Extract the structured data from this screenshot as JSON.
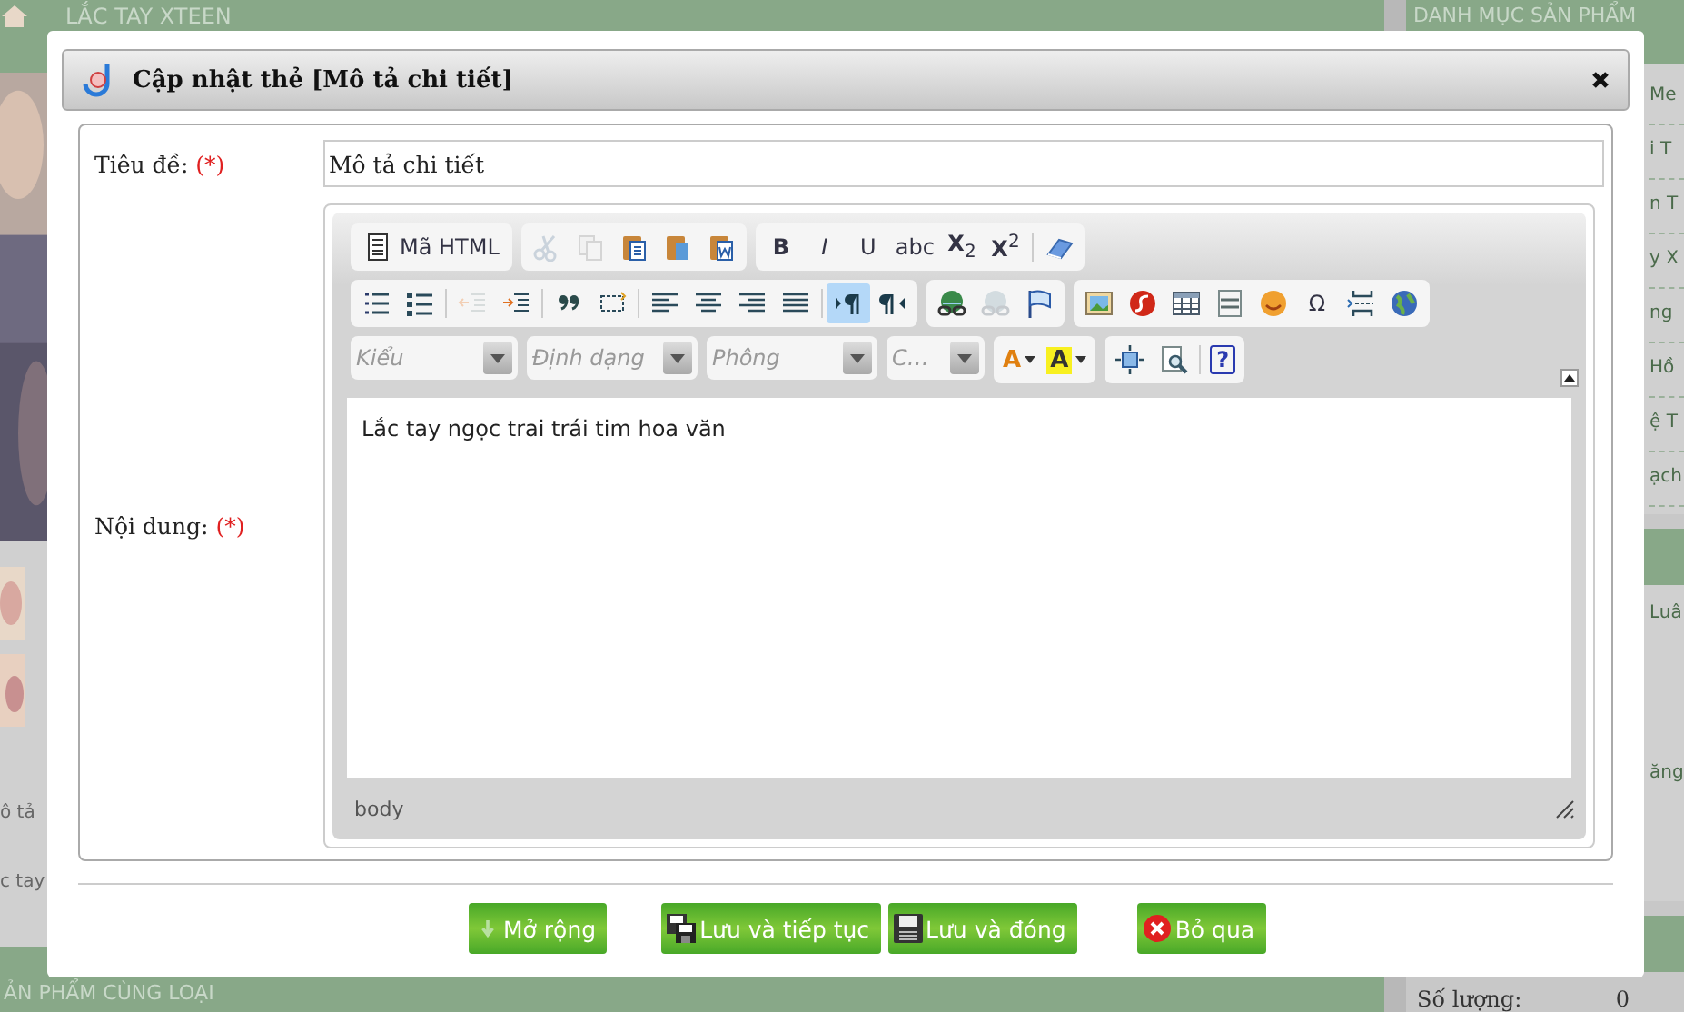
{
  "page": {
    "header": "LẮC TAY XTEEN",
    "footer_heading": "ẢN PHẨM CÙNG LOẠI",
    "left_texts": [
      "ô tả",
      "c tay"
    ],
    "sidebar": {
      "title": "DANH MỤC SẢN PHẨM",
      "items": [
        "Me",
        "i T",
        "n T",
        "y X",
        "ng",
        "Hồ",
        "ệ T",
        "ạch"
      ],
      "texts": [
        "Luâ",
        "ăng"
      ],
      "quantity_label": "Số lượng:",
      "quantity": "0"
    }
  },
  "dialog": {
    "title": "Cập nhật thẻ [Mô tả chi tiết]",
    "fields": [
      {
        "label": "Tiêu đề:",
        "required": "(*)",
        "value": "Mô tả chi tiết"
      },
      {
        "label": "Nội dung:",
        "required": "(*)"
      }
    ],
    "editor": {
      "toolbar": [
        [
          [
            {
              "kind": "source",
              "label": "Mã HTML",
              "selected": false,
              "disabled": false
            }
          ],
          [
            {
              "kind": "icon",
              "selected": false,
              "disabled": true
            },
            {
              "kind": "icon",
              "selected": false,
              "disabled": true
            },
            {
              "kind": "icon",
              "selected": false,
              "disabled": false
            },
            {
              "kind": "icon",
              "selected": false,
              "disabled": false
            },
            {
              "kind": "icon",
              "selected": false,
              "disabled": false
            }
          ],
          [
            {
              "kind": "label",
              "label": "**B**",
              "selected": false,
              "disabled": false
            },
            {
              "kind": "label",
              "label": "*I*",
              "selected": false,
              "disabled": false
            },
            {
              "kind": "label",
              "label": "U",
              "selected": false,
              "disabled": false
            },
            {
              "kind": "label",
              "label": "abc",
              "selected": false,
              "disabled": false
            },
            {
              "kind": "label",
              "label": "**X**$_{2}$",
              "selected": false,
              "disabled": false
            },
            {
              "kind": "label",
              "label": "**X**$^{2}$",
              "selected": false,
              "disabled": false
            },
            {
              "kind": "separator"
            },
            {
              "kind": "icon",
              "selected": false,
              "disabled": false
            }
          ]
        ],
        [
          [
            {
              "kind": "icon",
              "selected": false,
              "disabled": false
            },
            {
              "kind": "icon",
              "selected": false,
              "disabled": false
            },
            {
              "kind": "separator"
            },
            {
              "kind": "icon",
              "selected": false,
              "disabled": true
            },
            {
              "kind": "icon",
              "selected": false,
              "disabled": false
            },
            {
              "kind": "separator"
            },
            {
              "kind": "icon",
              "selected": false,
              "disabled": false
            },
            {
              "kind": "icon",
              "selected": false,
              "disabled": false
            },
            {
              "kind": "separator"
            },
            {
              "kind": "icon",
              "selected": false,
              "disabled": false
            },
            {
              "kind": "icon",
              "selected": false,
              "disabled": false
            },
            {
              "kind": "icon",
              "selected": false,
              "disabled": false
            },
            {
              "kind": "icon",
              "selected": false,
              "disabled": false
            },
            {
              "kind": "separator"
            },
            {
              "kind": "icon",
              "selected": true,
              "disabled": false
            },
            {
              "kind": "icon",
              "selected": false,
              "disabled": false
            }
          ],
          [
            {
              "kind": "icon",
              "selected": false,
              "disabled": false
            },
            {
              "kind": "icon",
              "selected": false,
              "disabled": true
            },
            {
              "kind": "icon",
              "selected": false,
              "disabled": false
            }
          ],
          [
            {
              "kind": "icon",
              "selected": false,
              "disabled": false
            },
            {
              "kind": "icon",
              "selected": false,
              "disabled": false
            },
            {
              "kind": "icon",
              "selected": false,
              "disabled": false
            },
            {
              "kind": "icon",
              "selected": false,
              "disabled": false
            },
            {
              "kind": "icon",
              "selected": false,
              "disabled": false
            },
            {
              "kind": "label",
              "label": "Ω",
              "selected": false,
              "disabled": false
            },
            {
              "kind": "icon",
              "selected": false,
              "disabled": false
            },
            {
              "kind": "icon",
              "selected": false,
              "disabled": false
            }
          ]
        ],
        [
          [
            {
              "kind": "dropdown",
              "placeholder": "Kiểu"
            }
          ],
          [
            {
              "kind": "dropdown",
              "placeholder": "Định dạng"
            }
          ],
          [
            {
              "kind": "dropdown",
              "placeholder": "Phông"
            }
          ],
          [
            {
              "kind": "dropdown",
              "placeholder": "C…"
            }
          ],
          [
            {
              "kind": "color",
              "label": "A",
              "selected": false,
              "disabled": false
            },
            {
              "kind": "color",
              "label": "A",
              "selected": false,
              "disabled": false
            }
          ],
          [
            {
              "kind": "icon",
              "selected": false,
              "disabled": false
            },
            {
              "kind": "icon",
              "selected": false,
              "disabled": false
            },
            {
              "kind": "separator"
            },
            {
              "kind": "help",
              "label": "?",
              "selected": false,
              "disabled": false
            }
          ]
        ]
      ],
      "content": "Lắc tay ngọc trai trái tim hoa văn",
      "path": "body"
    },
    "buttons": [
      "Mở rộng",
      "Lưu và tiếp tục",
      "Lưu và đóng",
      "Bỏ qua"
    ]
  }
}
